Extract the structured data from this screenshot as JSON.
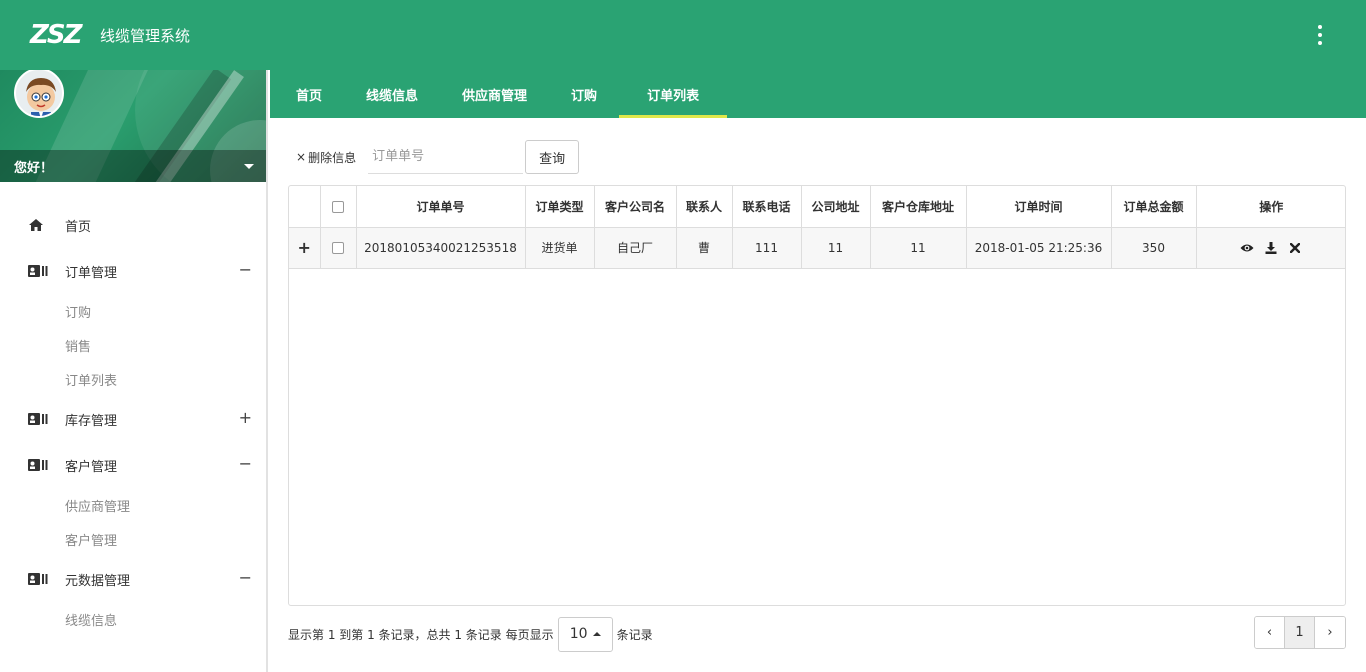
{
  "header": {
    "logo": "ZSZ",
    "title": "线缆管理系统"
  },
  "user": {
    "greeting": "您好！"
  },
  "sidebar": {
    "items": [
      {
        "label": "首页",
        "toggle": ""
      },
      {
        "label": "订单管理",
        "toggle": "−",
        "children": [
          "订购",
          "销售",
          "订单列表"
        ]
      },
      {
        "label": "库存管理",
        "toggle": "+"
      },
      {
        "label": "客户管理",
        "toggle": "−",
        "children": [
          "供应商管理",
          "客户管理"
        ]
      },
      {
        "label": "元数据管理",
        "toggle": "−",
        "children": [
          "线缆信息"
        ]
      }
    ]
  },
  "tabs": [
    {
      "label": "首页"
    },
    {
      "label": "线缆信息"
    },
    {
      "label": "供应商管理"
    },
    {
      "label": "订购"
    },
    {
      "label": "订单列表",
      "active": true
    }
  ],
  "toolbar": {
    "delete_label": "删除信息",
    "search_placeholder": "订单单号",
    "query_label": "查询"
  },
  "table": {
    "columns": [
      "订单单号",
      "订单类型",
      "客户公司名",
      "联系人",
      "联系电话",
      "公司地址",
      "客户仓库地址",
      "订单时间",
      "订单总金额",
      "操作"
    ],
    "rows": [
      {
        "order_no": "20180105340021253518",
        "type": "进货单",
        "company": "自己厂",
        "contact": "曹",
        "phone": "111",
        "address": "11",
        "warehouse": "11",
        "time": "2018-01-05 21:25:36",
        "amount": "350"
      }
    ]
  },
  "pagination": {
    "info_prefix": "显示第 1 到第 1 条记录，总共 1 条记录 每页显示",
    "page_size": "10",
    "info_suffix": "条记录",
    "prev": "‹",
    "current": "1",
    "next": "›"
  },
  "colors": {
    "primary": "#2aa373",
    "tab_underline": "#dfe74a"
  }
}
